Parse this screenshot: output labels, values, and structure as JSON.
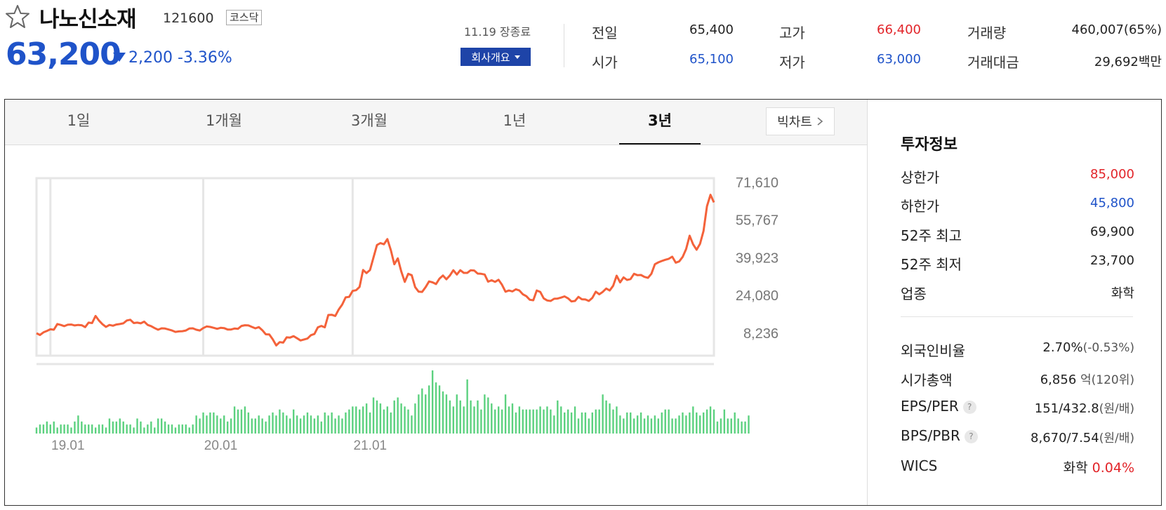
{
  "header": {
    "name": "나노신소재",
    "code": "121600",
    "market": "코스닥",
    "price": "63,200",
    "change": "2,200",
    "change_pct": "-3.36%",
    "date_status": "11.19 장종료",
    "company_button": "회사개요"
  },
  "summary": [
    {
      "label": "전일",
      "value": "65,400",
      "color": "#222222"
    },
    {
      "label": "고가",
      "value": "66,400",
      "color": "#e2252a"
    },
    {
      "label": "거래량",
      "value": "460,007(65%)",
      "color": "#222222"
    },
    {
      "label": "시가",
      "value": "65,100",
      "color": "#1f53c9"
    },
    {
      "label": "저가",
      "value": "63,000",
      "color": "#1f53c9"
    },
    {
      "label": "거래대금",
      "value": "29,692백만",
      "color": "#222222"
    }
  ],
  "tabs": [
    "1일",
    "1개월",
    "3개월",
    "1년",
    "3년"
  ],
  "active_tab": "3년",
  "big_chart_label": "빅차트",
  "investment": {
    "title": "투자정보",
    "rows": [
      {
        "label": "상한가",
        "value": "85,000",
        "color": "#e2252a"
      },
      {
        "label": "하한가",
        "value": "45,800",
        "color": "#1f53c9"
      },
      {
        "label": "52주 최고",
        "value": "69,900",
        "color": "#222222"
      },
      {
        "label": "52주 최저",
        "value": "23,700",
        "color": "#222222"
      },
      {
        "label": "업종",
        "value": "화학",
        "color": "#222222"
      }
    ],
    "foreign_ratio": {
      "label": "외국인비율",
      "value": "2.70%",
      "sub": "(-0.53%)"
    },
    "market_cap": {
      "label": "시가총액",
      "value": "6,856",
      "unit": "억",
      "sub": "(120위)"
    },
    "eps_per": {
      "label": "EPS/PER",
      "value": "151/432.8",
      "sub": "(원/배)"
    },
    "bps_pbr": {
      "label": "BPS/PBR",
      "value": "8,670/7.54",
      "sub": "(원/배)"
    },
    "wics": {
      "label": "WICS",
      "value": "화학",
      "pct": "0.04%"
    },
    "help_icon": "?"
  },
  "chart_data": {
    "type": "line",
    "y_ticks": [
      "71,610",
      "55,767",
      "39,923",
      "24,080",
      "8,236"
    ],
    "y_tick_values": [
      71610,
      55767,
      39923,
      24080,
      8236
    ],
    "x_ticks": [
      "19.01",
      "20.01",
      "21.01"
    ],
    "x_tick_index": [
      4,
      48,
      91
    ],
    "price_color": "#f4623a",
    "volume_color": "#5cd17f",
    "price": [
      8230,
      7500,
      8600,
      9200,
      9900,
      9700,
      12100,
      11700,
      11200,
      11800,
      11900,
      11500,
      11700,
      11600,
      10800,
      12700,
      12500,
      15500,
      13500,
      12000,
      10900,
      11700,
      11400,
      11900,
      12100,
      12400,
      13600,
      13900,
      12500,
      12700,
      12400,
      13100,
      11700,
      11200,
      10400,
      9700,
      10300,
      10200,
      9800,
      9400,
      8800,
      9000,
      9100,
      9400,
      10200,
      10300,
      9700,
      9400,
      10400,
      11100,
      10900,
      10500,
      10100,
      10500,
      10400,
      9800,
      9800,
      10200,
      10100,
      11300,
      11600,
      11500,
      10900,
      10300,
      10800,
      9500,
      7800,
      7700,
      5700,
      3100,
      4500,
      4300,
      6500,
      6400,
      7000,
      6100,
      5200,
      5600,
      6000,
      7400,
      7900,
      10700,
      11300,
      10700,
      15900,
      16000,
      15500,
      18200,
      20300,
      23300,
      23500,
      26000,
      26300,
      27700,
      34800,
      33500,
      34800,
      40000,
      45300,
      46100,
      45600,
      47800,
      43100,
      37200,
      39700,
      34200,
      29800,
      33200,
      32600,
      27600,
      25700,
      25600,
      27600,
      30000,
      29600,
      28900,
      31200,
      32500,
      30900,
      32500,
      34700,
      32900,
      34700,
      33600,
      33600,
      34700,
      34600,
      33300,
      33200,
      32900,
      29900,
      30500,
      29800,
      30700,
      28600,
      25700,
      26200,
      25800,
      26700,
      26200,
      24600,
      23800,
      22300,
      22100,
      26200,
      25600,
      22900,
      22000,
      21800,
      22700,
      22800,
      23200,
      23700,
      22900,
      21600,
      21800,
      23500,
      22500,
      22400,
      21800,
      23100,
      25700,
      24600,
      25600,
      27000,
      26200,
      28200,
      32400,
      29600,
      31700,
      30600,
      31000,
      33200,
      32600,
      32700,
      31900,
      31500,
      33200,
      37200,
      38000,
      38600,
      39100,
      39500,
      40400,
      37900,
      38400,
      40300,
      43600,
      49200,
      45600,
      43300,
      45800,
      51200,
      61600,
      66400,
      63200
    ],
    "volume": [
      2,
      3,
      3,
      4,
      3,
      4,
      2,
      3,
      3,
      3,
      2,
      4,
      6,
      4,
      3,
      3,
      3,
      2,
      3,
      3,
      2,
      5,
      4,
      4,
      5,
      4,
      3,
      3,
      2,
      5,
      4,
      2,
      3,
      4,
      2,
      5,
      5,
      4,
      3,
      3,
      2,
      3,
      3,
      3,
      2,
      3,
      6,
      5,
      7,
      6,
      7,
      7,
      6,
      5,
      6,
      4,
      5,
      9,
      8,
      8,
      9,
      7,
      5,
      5,
      6,
      5,
      4,
      6,
      7,
      6,
      8,
      7,
      6,
      5,
      8,
      6,
      5,
      6,
      7,
      6,
      5,
      6,
      4,
      7,
      6,
      7,
      5,
      6,
      5,
      7,
      8,
      9,
      9,
      8,
      9,
      10,
      7,
      12,
      11,
      10,
      8,
      9,
      7,
      11,
      12,
      10,
      9,
      8,
      6,
      10,
      13,
      15,
      13,
      16,
      21,
      17,
      16,
      14,
      13,
      11,
      9,
      13,
      11,
      9,
      18,
      11,
      9,
      11,
      8,
      13,
      12,
      10,
      8,
      9,
      8,
      13,
      9,
      10,
      7,
      9,
      8,
      8,
      8,
      8,
      8,
      9,
      8,
      9,
      8,
      6,
      11,
      9,
      7,
      8,
      7,
      9,
      5,
      7,
      7,
      5,
      7,
      8,
      8,
      13,
      11,
      10,
      8,
      9,
      6,
      5,
      7,
      7,
      5,
      6,
      7,
      5,
      6,
      5,
      6,
      5,
      7,
      8,
      8,
      5,
      5,
      6,
      7,
      6,
      7,
      9,
      7,
      6,
      7,
      8,
      9,
      8,
      4,
      5,
      8,
      5,
      5,
      7,
      5,
      4,
      4,
      6
    ]
  }
}
